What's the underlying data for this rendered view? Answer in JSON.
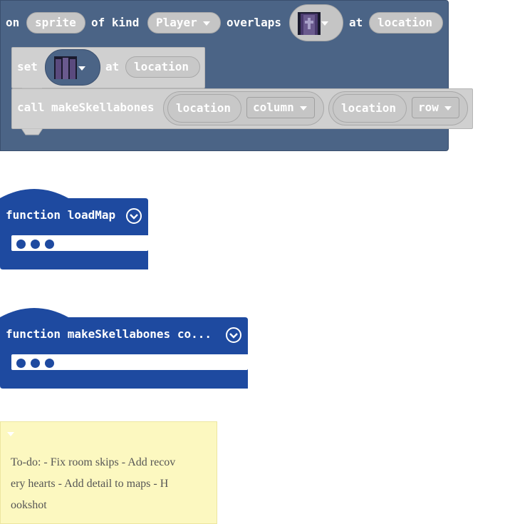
{
  "event_block": {
    "kw_on": "on",
    "sprite_var": "sprite",
    "kw_of_kind": "of kind",
    "kind_value": "Player",
    "kw_overlaps": "overlaps",
    "tile_icon": "tombstone-tile-icon",
    "kw_at": "at",
    "location_var": "location"
  },
  "set_block": {
    "kw_set": "set",
    "tile_icon": "purple-wall-tile-icon",
    "kw_at": "at",
    "location_var": "location"
  },
  "call_block": {
    "kw_call": "call",
    "function_name": "makeSkellabones",
    "arg1_var": "location",
    "arg1_prop": "column",
    "arg2_var": "location",
    "arg2_prop": "row"
  },
  "function_blocks": [
    {
      "title": "function loadMap"
    },
    {
      "title": "function makeSkellabones co..."
    }
  ],
  "comment": {
    "lines": [
      "To-do: - Fix room skips - Add recov",
      "ery hearts - Add detail to maps - H",
      "ookshot"
    ]
  },
  "colors": {
    "event_block": "#4b6486",
    "event_border": "#3a4f6e",
    "stmt_block": "#d0d0d0",
    "function_block": "#1e4aa0",
    "comment_bg": "#fcf8c0"
  }
}
